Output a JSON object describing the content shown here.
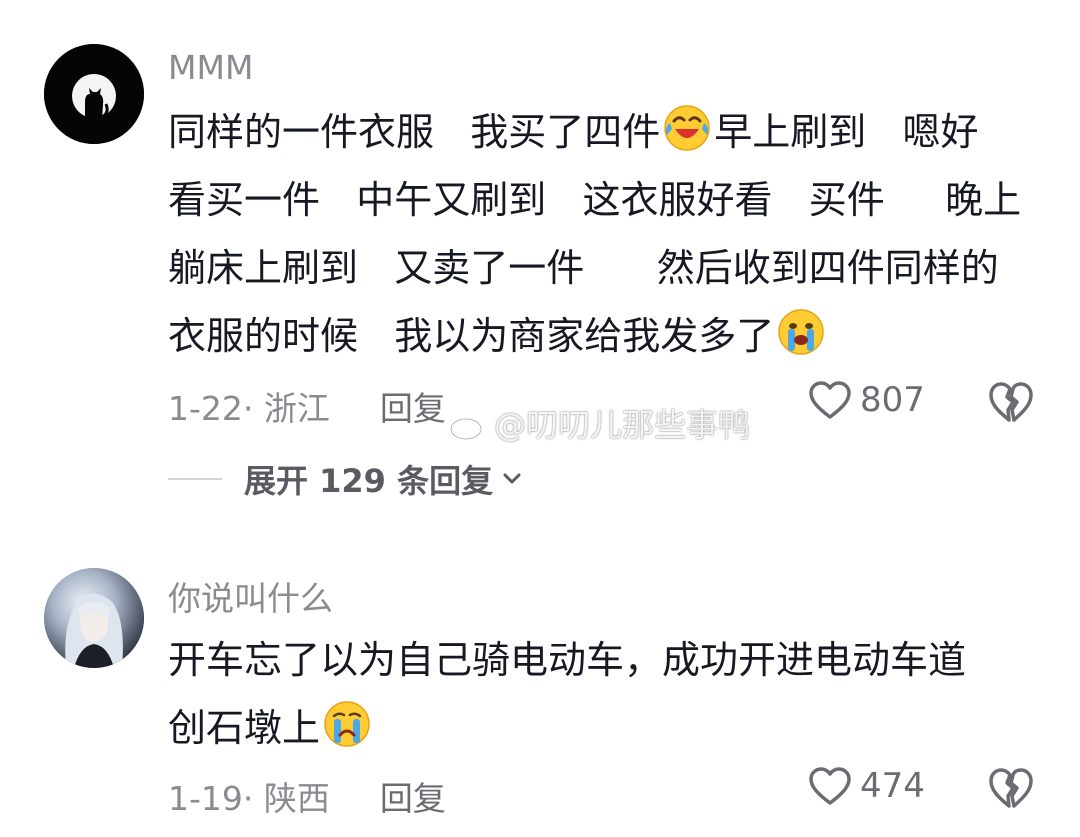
{
  "comments": [
    {
      "username": "MMM",
      "lines": [
        [
          "同样的一件衣服   我买了四件",
          "早上刷到   嗯好"
        ],
        [
          "看买一件   中午又刷到   这衣服好看   买件     晚上"
        ],
        [
          "躺床上刷到   又卖了一件      然后收到四件同样的"
        ],
        [
          "衣服的时候   我以为商家给我发多了",
          ""
        ]
      ],
      "emojis": [
        "laughing-crying-emoji",
        "crying-emoji"
      ],
      "date": "1-22",
      "location": "浙江",
      "date_sep": "·",
      "reply_label": "回复",
      "likes": "807",
      "expand_label": "展开 129 条回复"
    },
    {
      "username": "你说叫什么",
      "lines": [
        [
          "开车忘了以为自己骑电动车，成功开进电动车道"
        ],
        [
          "创石墩上",
          ""
        ]
      ],
      "emojis": [
        "sad-crying-emoji"
      ],
      "date": "1-19",
      "location": "陕西",
      "date_sep": "·",
      "reply_label": "回复",
      "likes": "474"
    }
  ],
  "watermark": "@叨叨儿那些事鸭",
  "icons": {
    "like": "heart-outline-icon",
    "dislike": "broken-heart-icon",
    "expand": "chevron-down-icon",
    "watermark_logo": "weibo-logo-icon"
  },
  "colors": {
    "text": "#161823",
    "secondary": "#8a8b91",
    "emoji_yellow": "#ffcc33",
    "tear_blue": "#4aa8e8"
  }
}
